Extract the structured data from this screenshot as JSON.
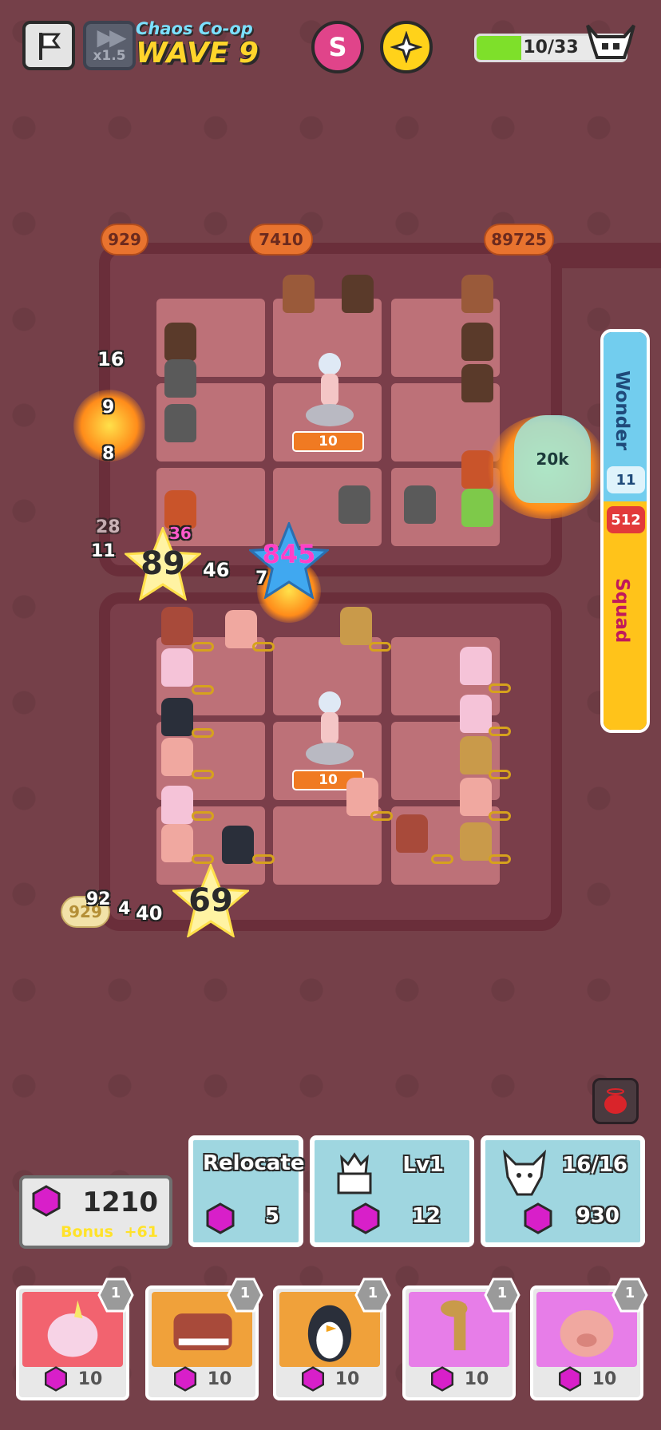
{
  "hud": {
    "speed_label": "x1.5",
    "mode_label": "Chaos Co-op",
    "wave_label": "WAVE 9",
    "boss_progress": "10/33",
    "boss_fraction": 0.303,
    "skill_glyph": "S"
  },
  "board": {
    "spawn_counters": [
      "929",
      "7410",
      "89725",
      "929"
    ],
    "floating_damage": [
      "16",
      "9",
      "8",
      "28",
      "11",
      "46",
      "7",
      "92",
      "4",
      "40",
      "36"
    ],
    "star_damage": [
      "89",
      "845",
      "69"
    ],
    "statue_levels": [
      "10",
      "10"
    ],
    "boss_hp": "20k"
  },
  "side_panel": {
    "wonder_label": "Wonder",
    "wonder_count": "11",
    "squad_count": "512",
    "squad_label": "Squad"
  },
  "resources": {
    "gems": "1210",
    "bonus_label": "Bonus",
    "bonus_value": "+61"
  },
  "actions": [
    {
      "label": "Relocate",
      "cost": "5"
    },
    {
      "label": "Lv1",
      "cost": "12"
    },
    {
      "label": "16/16",
      "cost": "930"
    }
  ],
  "shop": [
    {
      "name": "unicorn",
      "cost": "10",
      "level": "1",
      "color": "#f2636f"
    },
    {
      "name": "trex",
      "cost": "10",
      "level": "1",
      "color": "#f0a13a"
    },
    {
      "name": "penguin",
      "cost": "10",
      "level": "1",
      "color": "#f0a13a"
    },
    {
      "name": "giraffe",
      "cost": "10",
      "level": "1",
      "color": "#e77de8"
    },
    {
      "name": "pig",
      "cost": "10",
      "level": "1",
      "color": "#e77de8"
    }
  ],
  "colors": {
    "background": "#754049",
    "board": "#6a2e3a",
    "cell": "#c97a80",
    "gem": "#d81fc9",
    "accent_yellow": "#ffd52b",
    "accent_cyan": "#7be0ff"
  }
}
